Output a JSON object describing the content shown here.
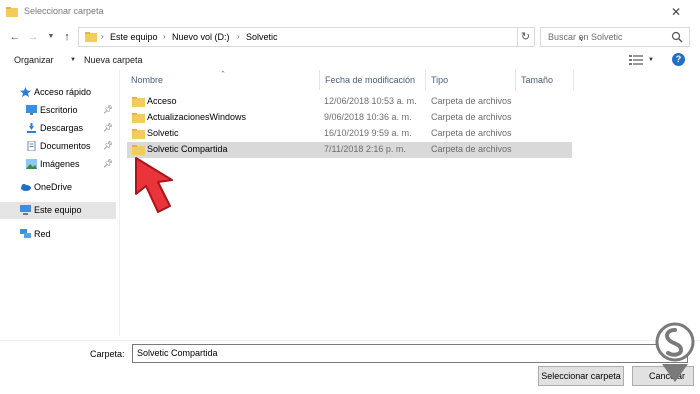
{
  "window": {
    "title": "Seleccionar carpeta"
  },
  "address": {
    "crumbs": [
      "Este equipo",
      "Nuevo vol (D:)",
      "Solvetic"
    ]
  },
  "search": {
    "placeholder": "Buscar en Solvetic"
  },
  "toolbar": {
    "organize_label": "Organizar",
    "new_folder_label": "Nueva carpeta"
  },
  "nav": {
    "quick_access": "Acceso rápido",
    "items": [
      {
        "label": "Escritorio",
        "icon": "desktop-icon"
      },
      {
        "label": "Descargas",
        "icon": "downloads-icon"
      },
      {
        "label": "Documentos",
        "icon": "documents-icon"
      },
      {
        "label": "Imágenes",
        "icon": "pictures-icon"
      }
    ],
    "onedrive": "OneDrive",
    "this_pc": "Este equipo",
    "network": "Red"
  },
  "columns": [
    "Nombre",
    "Fecha de modificación",
    "Tipo",
    "Tamaño"
  ],
  "files": [
    {
      "name": "Acceso",
      "date": "12/06/2018 10:53 a. m.",
      "type": "Carpeta de archivos"
    },
    {
      "name": "ActualizacionesWindows",
      "date": "9/06/2018 10:36 a. m.",
      "type": "Carpeta de archivos"
    },
    {
      "name": "Solvetic",
      "date": "16/10/2019 9:59 a. m.",
      "type": "Carpeta de archivos"
    },
    {
      "name": "Solvetic Compartida",
      "date": "7/11/2018 2:16 p. m.",
      "type": "Carpeta de archivos"
    }
  ],
  "footer": {
    "folder_label": "Carpeta:",
    "folder_value": "Solvetic Compartida",
    "select_label": "Seleccionar carpeta",
    "cancel_label": "Cancelar"
  },
  "colors": {
    "folder_yellow": "#f4cc5c",
    "selection": "#d9d9d9",
    "arrow_red": "#e8343a",
    "accent_blue": "#1f6fc5"
  }
}
